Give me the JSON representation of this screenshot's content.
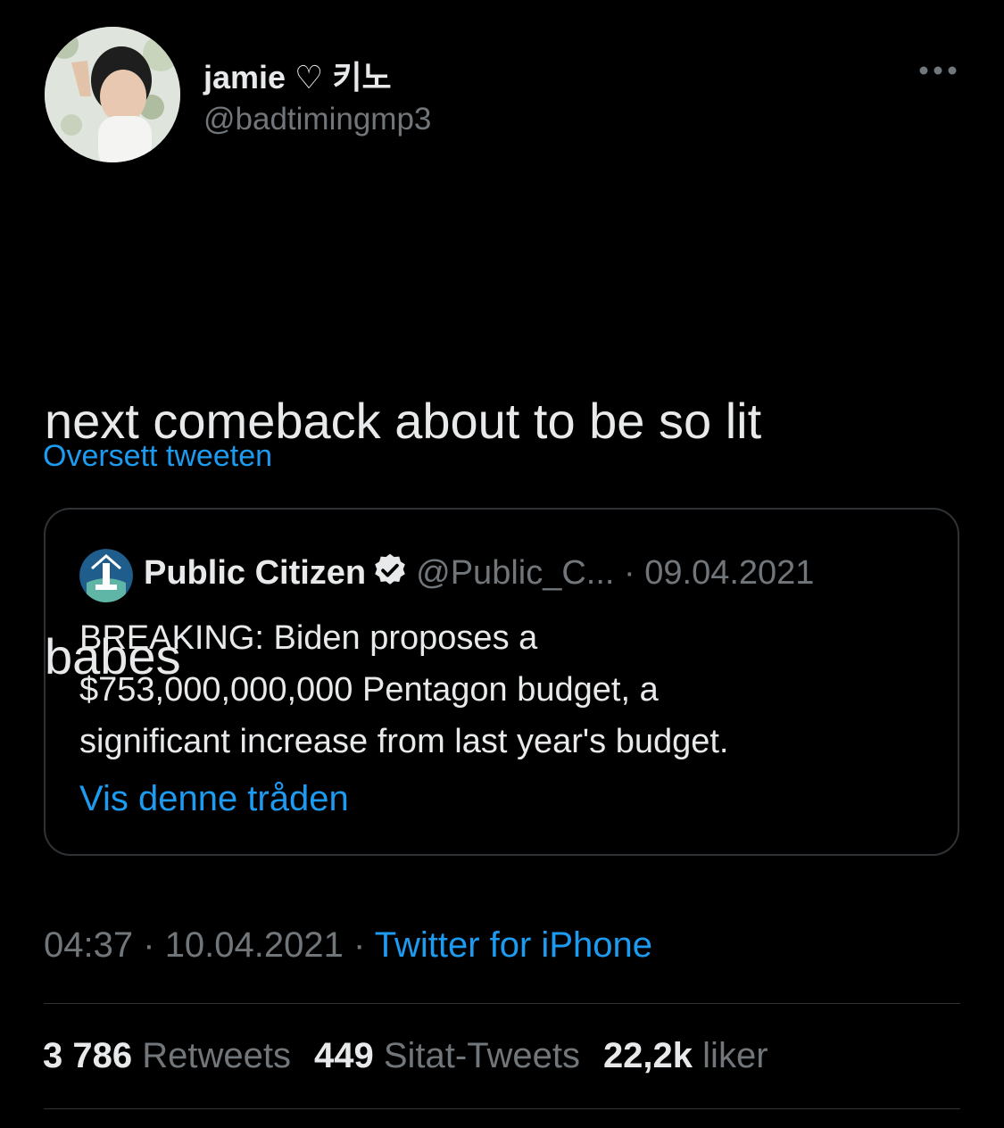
{
  "author": {
    "display_name": "jamie ♡ 키노",
    "handle": "@badtimingmp3"
  },
  "tweet": {
    "text_lines": [
      "next comeback about to be so lit",
      "babes"
    ],
    "translate_label": "Oversett tweeten"
  },
  "quoted_tweet": {
    "name": "Public Citizen",
    "handle": "@Public_C...",
    "separator": "·",
    "date": "09.04.2021",
    "text_lines": [
      "BREAKING: Biden proposes a",
      "$753,000,000,000 Pentagon budget, a",
      "significant increase from last year's budget."
    ],
    "thread_link": "Vis denne tråden",
    "verified_icon": "verified-badge-icon"
  },
  "meta": {
    "time": "04:37",
    "separator": "·",
    "date": "10.04.2021",
    "source": "Twitter for iPhone"
  },
  "stats": {
    "retweets": {
      "count": "3 786",
      "label": "Retweets"
    },
    "quotes": {
      "count": "449",
      "label": "Sitat-Tweets"
    },
    "likes": {
      "count": "22,2k",
      "label": "liker"
    }
  },
  "colors": {
    "background": "#000000",
    "text": "#e7e9ea",
    "secondary": "#71767b",
    "link": "#1d9bf0",
    "border": "#2f3336"
  },
  "icons": {
    "more": "more-horizontal-icon",
    "verified": "verified-badge-icon"
  }
}
